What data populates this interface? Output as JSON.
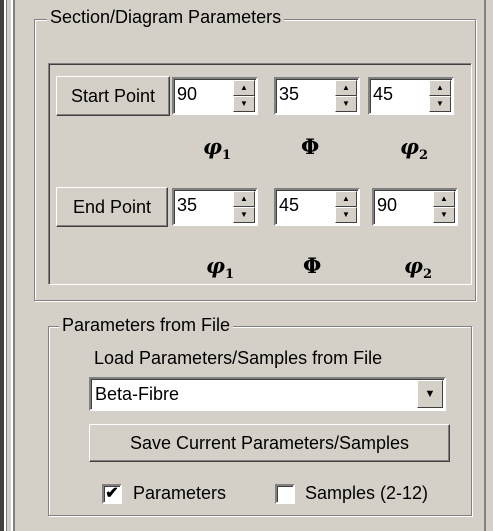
{
  "section_group": {
    "title": "Section/Diagram Parameters",
    "start_point": {
      "button_label": "Start Point",
      "values": [
        "90",
        "35",
        "45"
      ]
    },
    "end_point": {
      "button_label": "End Point",
      "values": [
        "35",
        "45",
        "90"
      ]
    },
    "angle_labels": {
      "phi1": "φ",
      "phi1_sub": "1",
      "Phi": "Φ",
      "phi2": "φ",
      "phi2_sub": "2"
    }
  },
  "file_group": {
    "title": "Parameters from File",
    "load_label": "Load Parameters/Samples from File",
    "selected_file": "Beta-Fibre",
    "save_button": "Save Current Parameters/Samples",
    "parameters_checkbox": {
      "label": "Parameters",
      "checked": true
    },
    "samples_checkbox": {
      "label": "Samples (2-12)",
      "checked": false
    }
  },
  "icons": {
    "spin_up": "▲",
    "spin_down": "▼",
    "dropdown": "▼",
    "check": "✔"
  }
}
